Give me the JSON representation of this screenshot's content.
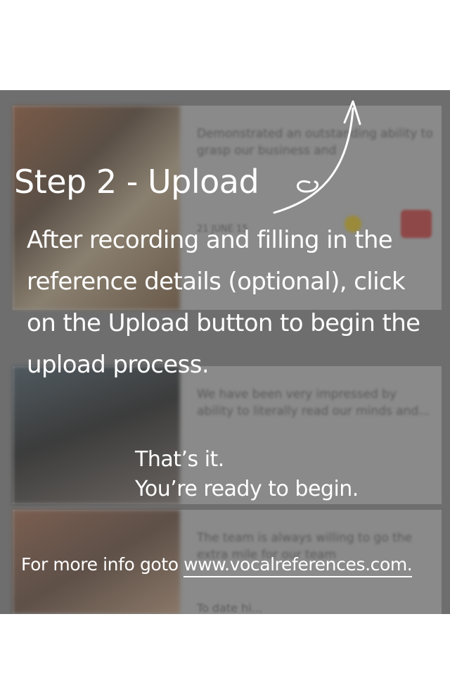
{
  "overlay": {
    "title": "Step 2 - Upload",
    "instructions": "After recording and filling in the reference details (optional), click on the Upload button to begin the upload process.",
    "done_line1": "That’s it.",
    "done_line2": "You’re ready to begin.",
    "more_info_prefix": "For more info goto ",
    "more_info_link": "www.vocalreferences.com."
  },
  "background": {
    "card1_snippet": "Demonstrated an outstanding ability to grasp our business and",
    "card1_meta": "21 JUNE 15",
    "card2_snippet": "We have been very impressed by ability to literally read our minds and...",
    "card3_snippet": "The team is always willing to go the extra mile for our team",
    "card4_snippet": "To date hi..."
  },
  "icons": {
    "next": "chevron-right-icon",
    "arrow": "curved-arrow-up-icon"
  },
  "colors": {
    "dim_overlay": "#6e6e6e",
    "text": "#ffffff",
    "page": "#ffffff"
  }
}
